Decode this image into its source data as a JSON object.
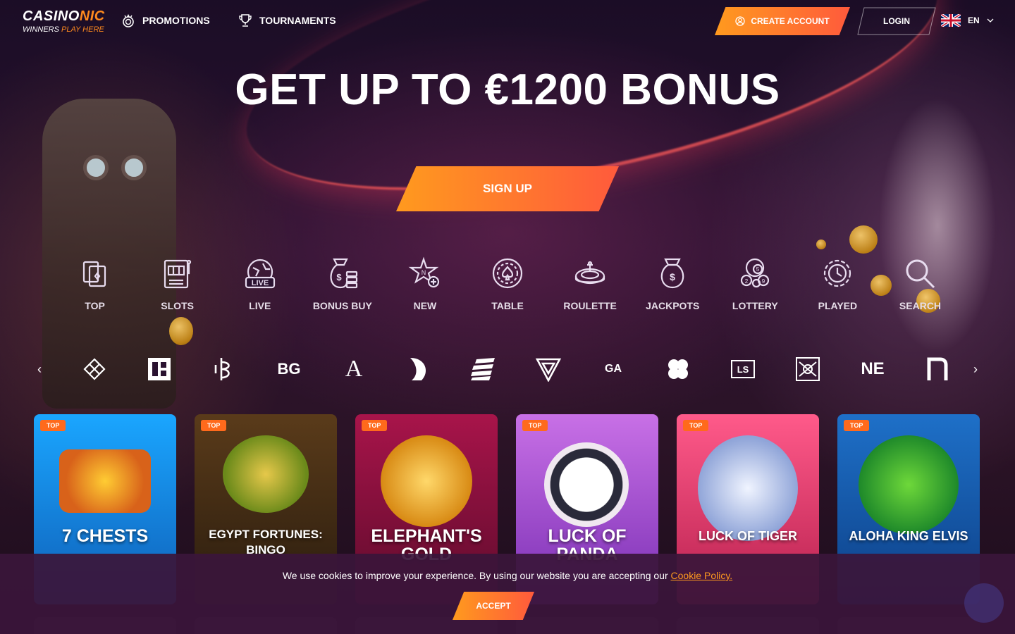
{
  "brand": {
    "name_part1": "CASINO",
    "name_part2": "NIC",
    "tagline_part1": "WINNERS ",
    "tagline_part2": "PLAY HERE"
  },
  "nav": {
    "promotions": "PROMOTIONS",
    "tournaments": "TOURNAMENTS"
  },
  "account": {
    "create_account": "CREATE ACCOUNT",
    "login": "LOGIN",
    "language": "EN"
  },
  "hero": {
    "title": "GET UP TO €1200 BONUS",
    "signup": "SIGN UP"
  },
  "categories": [
    {
      "label": "TOP",
      "icon": "cards-icon"
    },
    {
      "label": "SLOTS",
      "icon": "slot-machine-icon"
    },
    {
      "label": "LIVE",
      "icon": "live-icon"
    },
    {
      "label": "BONUS BUY",
      "icon": "money-bag-icon"
    },
    {
      "label": "NEW",
      "icon": "new-star-icon"
    },
    {
      "label": "TABLE",
      "icon": "spade-chip-icon"
    },
    {
      "label": "ROULETTE",
      "icon": "roulette-icon"
    },
    {
      "label": "JACKPOTS",
      "icon": "jackpot-bag-icon"
    },
    {
      "label": "LOTTERY",
      "icon": "lottery-balls-icon"
    },
    {
      "label": "PLAYED",
      "icon": "history-icon"
    },
    {
      "label": "SEARCH",
      "icon": "search-icon"
    }
  ],
  "providers": {
    "bg_text": "BG",
    "a_text": "A",
    "ga_text": "GA",
    "ls_text": "LS",
    "ne_text": "NE"
  },
  "games": [
    {
      "badge": "TOP",
      "title": "7 CHESTS",
      "colors": [
        "#1aa6ff",
        "#0f5fb8"
      ]
    },
    {
      "badge": "TOP",
      "title": "EGYPT FORTUNES: BINGO",
      "colors": [
        "#5a3b1a",
        "#2a1c0e"
      ]
    },
    {
      "badge": "TOP",
      "title": "ELEPHANT'S GOLD",
      "colors": [
        "#a8144a",
        "#5e0b2c"
      ]
    },
    {
      "badge": "TOP",
      "title": "LUCK OF PANDA",
      "colors": [
        "#c870e6",
        "#7a2fb4"
      ]
    },
    {
      "badge": "TOP",
      "title": "LUCK OF TIGER",
      "colors": [
        "#ff5a8a",
        "#b8204e"
      ]
    },
    {
      "badge": "TOP",
      "title": "ALOHA KING ELVIS",
      "colors": [
        "#1e70c8",
        "#0d3f86"
      ]
    }
  ],
  "cookie": {
    "text": "We use cookies to improve your experience. By using our website you are accepting our ",
    "link": "Cookie Policy.",
    "accept": "ACCEPT"
  }
}
